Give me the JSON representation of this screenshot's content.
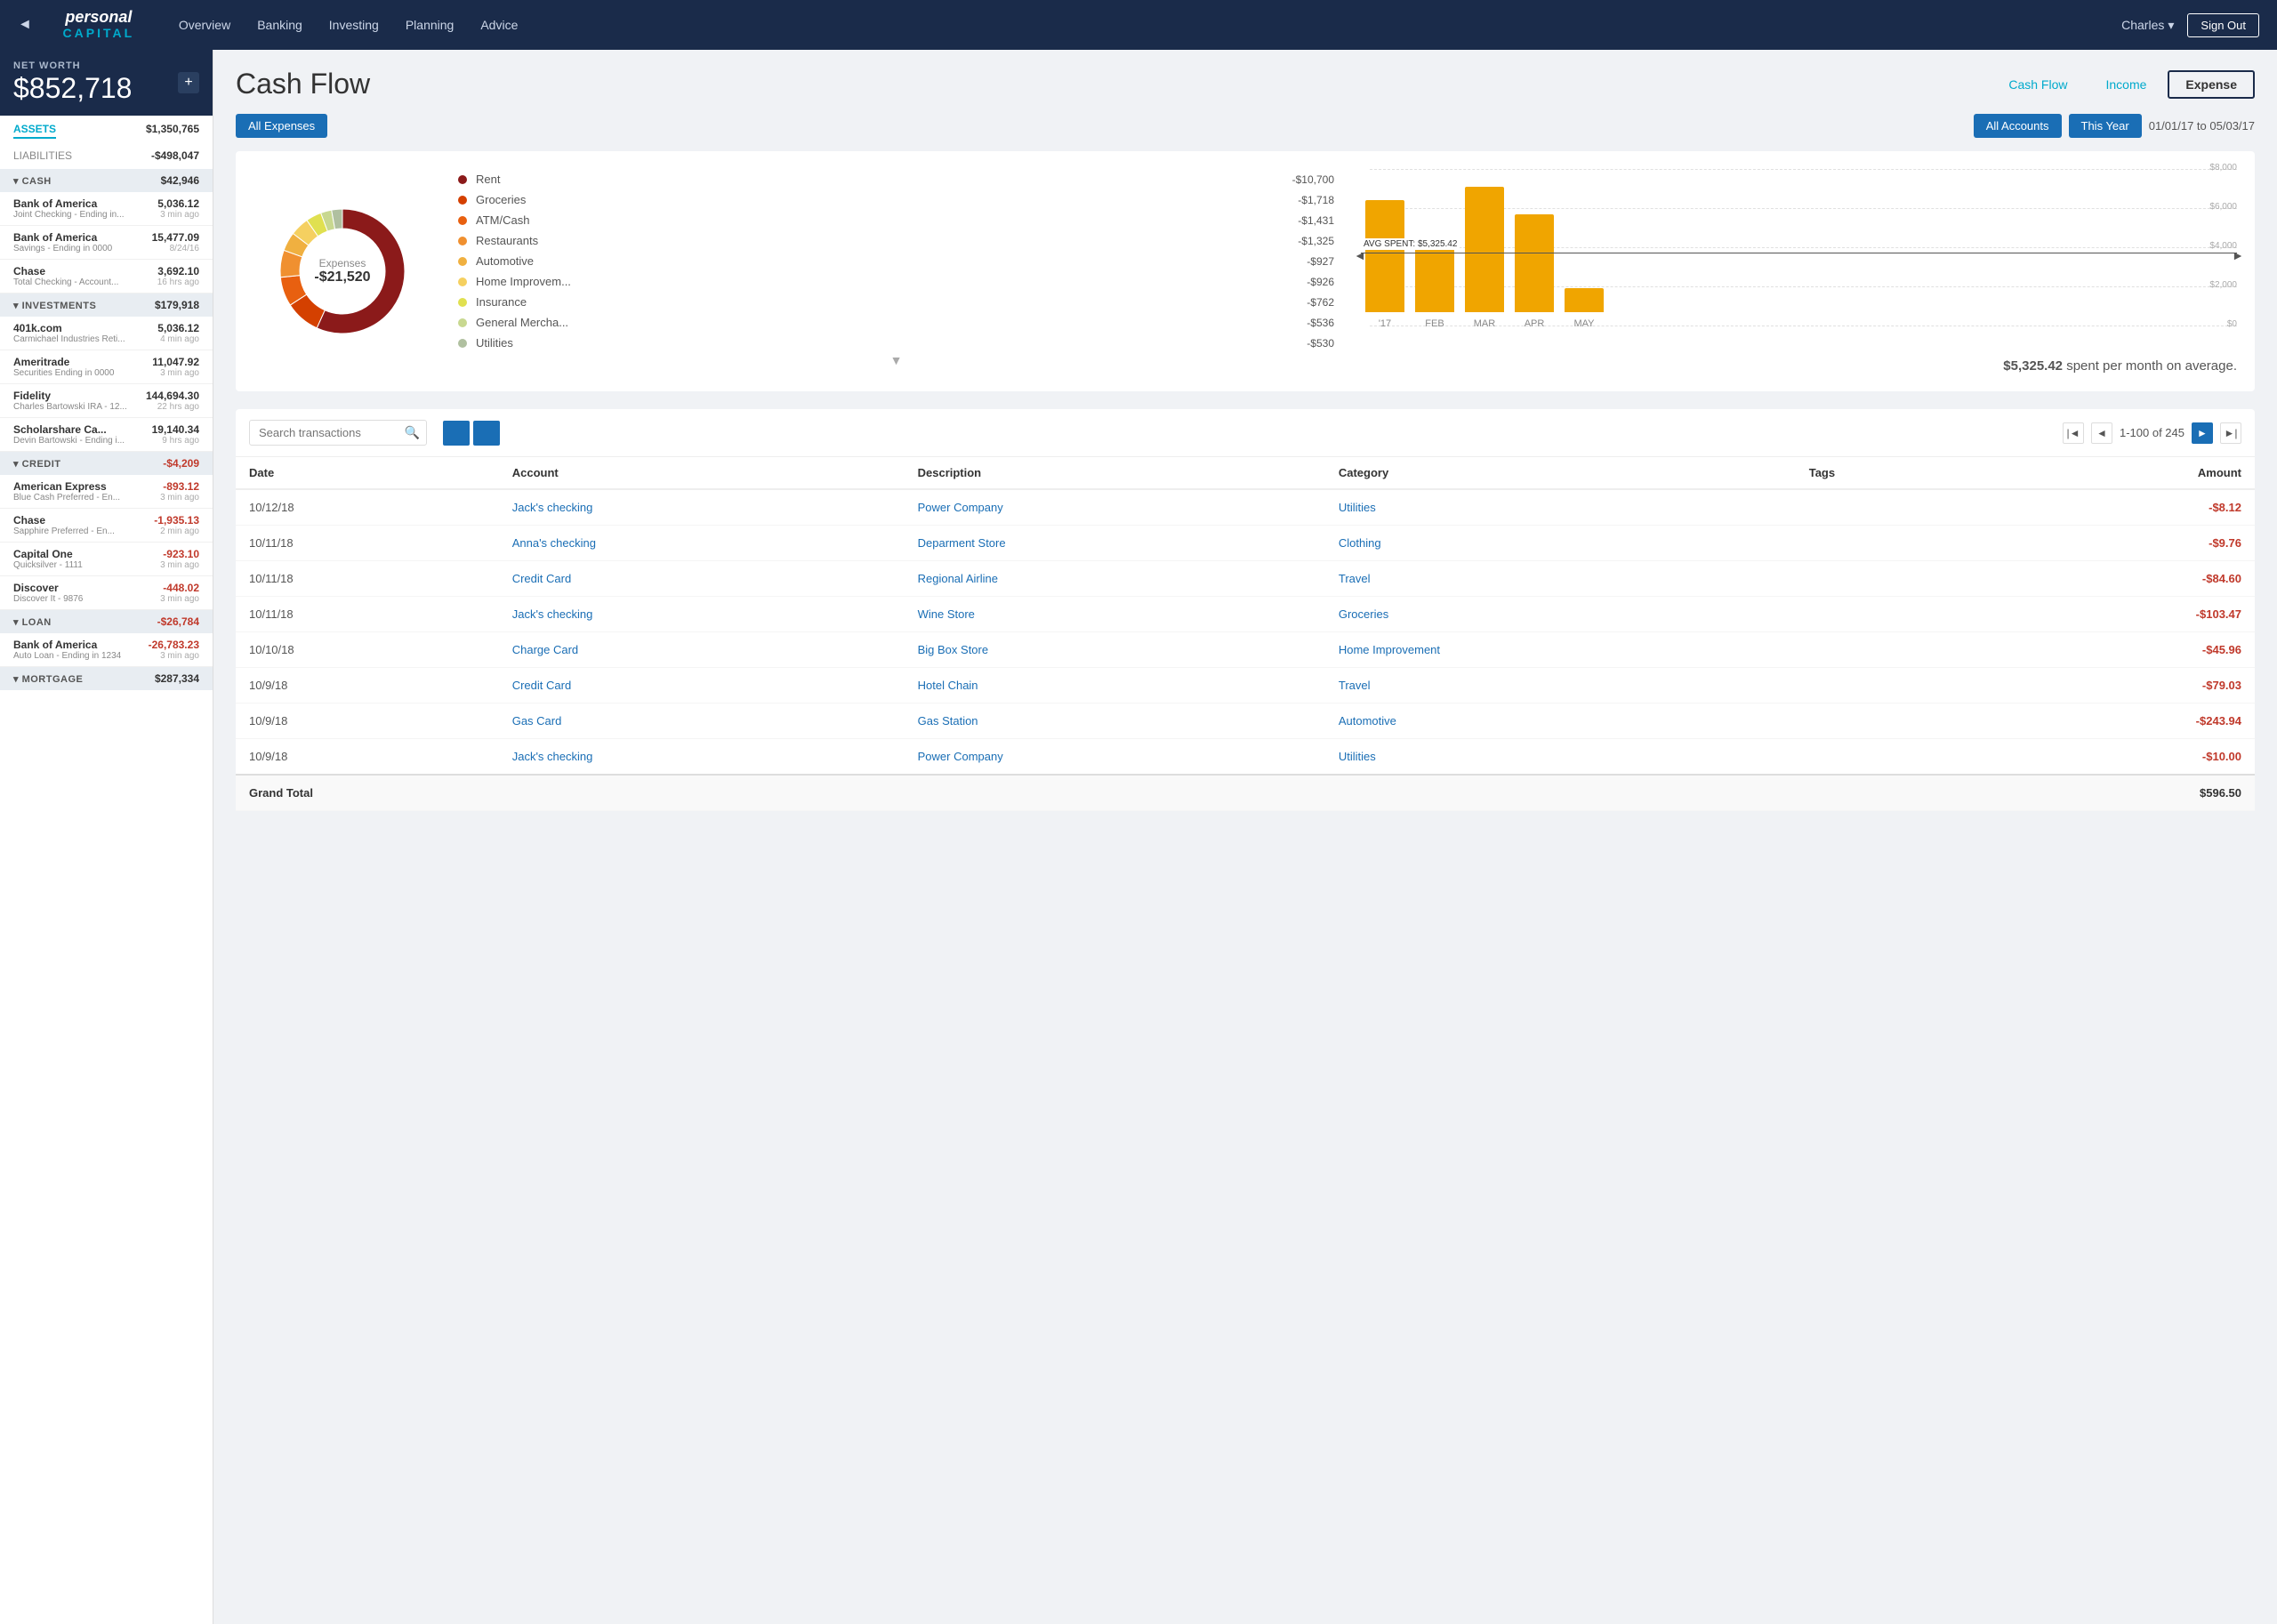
{
  "app": {
    "logo_personal": "personal",
    "logo_capital": "CAPITAL",
    "collapse_icon": "◄"
  },
  "nav": {
    "links": [
      "Overview",
      "Banking",
      "Investing",
      "Planning",
      "Advice"
    ],
    "user": "Charles",
    "user_icon": "▾",
    "signout": "Sign Out"
  },
  "sidebar": {
    "net_worth_label": "NET WORTH",
    "net_worth_value": "$852,718",
    "add_label": "+",
    "assets_label": "ASSETS",
    "assets_value": "$1,350,765",
    "liabilities_label": "LIABILITIES",
    "liabilities_value": "-$498,047",
    "sections": [
      {
        "name": "CASH",
        "total": "$42,946",
        "negative": false,
        "accounts": [
          {
            "name": "Bank of America",
            "sub": "Joint Checking - Ending in...",
            "amount": "5,036.12",
            "time": "3 min ago"
          },
          {
            "name": "Bank of America",
            "sub": "Savings - Ending in 0000",
            "amount": "15,477.09",
            "time": "8/24/16"
          },
          {
            "name": "Chase",
            "sub": "Total Checking - Account...",
            "amount": "3,692.10",
            "time": "16 hrs ago"
          }
        ]
      },
      {
        "name": "INVESTMENTS",
        "total": "$179,918",
        "negative": false,
        "accounts": [
          {
            "name": "401k.com",
            "sub": "Carmichael Industries Reti...",
            "amount": "5,036.12",
            "time": "4 min ago"
          },
          {
            "name": "Ameritrade",
            "sub": "Securities Ending in 0000",
            "amount": "11,047.92",
            "time": "3 min ago"
          },
          {
            "name": "Fidelity",
            "sub": "Charles Bartowski IRA - 12...",
            "amount": "144,694.30",
            "time": "22 hrs ago"
          },
          {
            "name": "Scholarshare Ca...",
            "sub": "Devin Bartowski - Ending i...",
            "amount": "19,140.34",
            "time": "9 hrs ago"
          }
        ]
      },
      {
        "name": "CREDIT",
        "total": "-$4,209",
        "negative": true,
        "accounts": [
          {
            "name": "American Express",
            "sub": "Blue Cash Preferred - En...",
            "amount": "-893.12",
            "time": "3 min ago"
          },
          {
            "name": "Chase",
            "sub": "Sapphire Preferred - En...",
            "amount": "-1,935.13",
            "time": "2 min ago"
          },
          {
            "name": "Capital One",
            "sub": "Quicksilver - 1111",
            "amount": "-923.10",
            "time": "3 min ago"
          },
          {
            "name": "Discover",
            "sub": "Discover It - 9876",
            "amount": "-448.02",
            "time": "3 min ago"
          }
        ]
      },
      {
        "name": "LOAN",
        "total": "-$26,784",
        "negative": true,
        "accounts": [
          {
            "name": "Bank of America",
            "sub": "Auto Loan - Ending in 1234",
            "amount": "-26,783.23",
            "time": "3 min ago"
          }
        ]
      },
      {
        "name": "MORTGAGE",
        "total": "$287,334",
        "negative": false,
        "accounts": []
      }
    ]
  },
  "page": {
    "title": "Cash Flow",
    "tabs": [
      "Cash Flow",
      "Income",
      "Expense"
    ],
    "active_tab": "Expense"
  },
  "filters": {
    "all_expenses": "All Expenses",
    "all_accounts": "All Accounts",
    "this_year": "This Year",
    "date_range": "01/01/17  to  05/03/17"
  },
  "chart": {
    "donut_label": "Expenses",
    "donut_value": "-$21,520",
    "legend": [
      {
        "label": "Rent",
        "amount": "-$10,700",
        "color": "#8b1a1a"
      },
      {
        "label": "Groceries",
        "amount": "-$1,718",
        "color": "#d44000"
      },
      {
        "label": "ATM/Cash",
        "amount": "-$1,431",
        "color": "#e86010"
      },
      {
        "label": "Restaurants",
        "amount": "-$1,325",
        "color": "#f09030"
      },
      {
        "label": "Automotive",
        "amount": "-$927",
        "color": "#f0b040"
      },
      {
        "label": "Home Improvem...",
        "amount": "-$926",
        "color": "#f5d060"
      },
      {
        "label": "Insurance",
        "amount": "-$762",
        "color": "#e0e050"
      },
      {
        "label": "General Mercha...",
        "amount": "-$536",
        "color": "#c8d890"
      },
      {
        "label": "Utilities",
        "amount": "-$530",
        "color": "#b0c0a0"
      }
    ],
    "bars": [
      {
        "label": "'17",
        "height": 110,
        "value": 5500
      },
      {
        "label": "FEB",
        "height": 65,
        "value": 3200
      },
      {
        "label": "MAR",
        "height": 140,
        "value": 7000
      },
      {
        "label": "APR",
        "height": 95,
        "value": 4800
      },
      {
        "label": "MAY",
        "height": 25,
        "value": 1200
      }
    ],
    "avg_value": "$5,325.42",
    "avg_label": "AVG SPENT: $5,325.42",
    "avg_height_pct": 55,
    "grid_labels": [
      "$8,000",
      "$6,000",
      "$4,000",
      "$2,000",
      "$0"
    ],
    "avg_spent_msg": "$5,325.42 spent per month on average."
  },
  "transactions": {
    "search_placeholder": "Search transactions",
    "pagination_text": "1-100 of 245",
    "columns": [
      "Date",
      "Account",
      "Description",
      "Category",
      "Tags",
      "Amount"
    ],
    "rows": [
      {
        "date": "10/12/18",
        "account": "Jack's checking",
        "description": "Power Company",
        "category": "Utilities",
        "tags": "",
        "amount": "-$8.12"
      },
      {
        "date": "10/11/18",
        "account": "Anna's checking",
        "description": "Deparment Store",
        "category": "Clothing",
        "tags": "",
        "amount": "-$9.76"
      },
      {
        "date": "10/11/18",
        "account": "Credit Card",
        "description": "Regional Airline",
        "category": "Travel",
        "tags": "",
        "amount": "-$84.60"
      },
      {
        "date": "10/11/18",
        "account": "Jack's checking",
        "description": "Wine Store",
        "category": "Groceries",
        "tags": "",
        "amount": "-$103.47"
      },
      {
        "date": "10/10/18",
        "account": "Charge Card",
        "description": "Big Box Store",
        "category": "Home Improvement",
        "tags": "",
        "amount": "-$45.96"
      },
      {
        "date": "10/9/18",
        "account": "Credit Card",
        "description": "Hotel Chain",
        "category": "Travel",
        "tags": "",
        "amount": "-$79.03"
      },
      {
        "date": "10/9/18",
        "account": "Gas Card",
        "description": "Gas Station",
        "category": "Automotive",
        "tags": "",
        "amount": "-$243.94"
      },
      {
        "date": "10/9/18",
        "account": "Jack's checking",
        "description": "Power Company",
        "category": "Utilities",
        "tags": "",
        "amount": "-$10.00"
      }
    ],
    "grand_total_label": "Grand Total",
    "grand_total_amount": "$596.50"
  }
}
